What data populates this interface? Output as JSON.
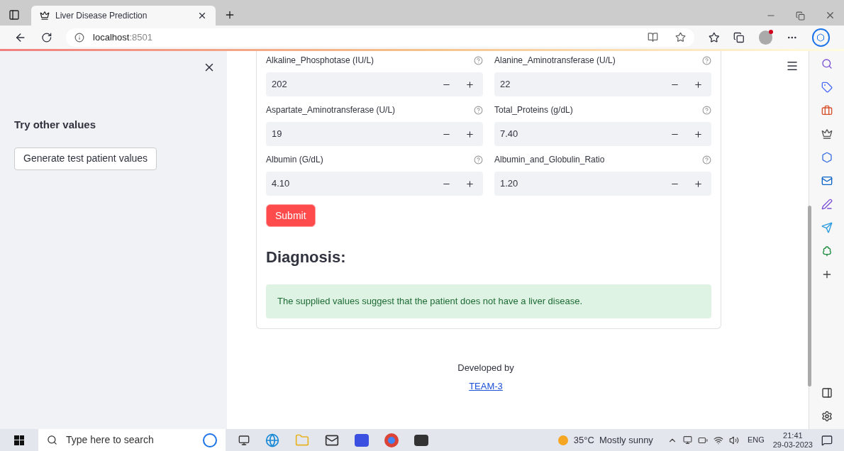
{
  "browser": {
    "tab_title": "Liver Disease Prediction",
    "url_host": "localhost",
    "url_port": ":8501"
  },
  "sidebar": {
    "heading": "Try other values",
    "button": "Generate test patient values"
  },
  "fields": [
    {
      "label": "Alkaline_Phosphotase (IU/L)",
      "value": "202"
    },
    {
      "label": "Alanine_Aminotransferase (U/L)",
      "value": "22"
    },
    {
      "label": "Aspartate_Aminotransferase (U/L)",
      "value": "19"
    },
    {
      "label": "Total_Proteins (g/dL)",
      "value": "7.40"
    },
    {
      "label": "Albumin (G/dL)",
      "value": "4.10"
    },
    {
      "label": "Albumin_and_Globulin_Ratio",
      "value": "1.20"
    }
  ],
  "submit": "Submit",
  "diagnosis": {
    "heading": "Diagnosis:",
    "message": "The supplied values suggest that the patient does not have a liver disease."
  },
  "footer": {
    "text": "Developed by",
    "link": "TEAM-3"
  },
  "taskbar": {
    "search_placeholder": "Type here to search",
    "weather": "35°C  Mostly sunny",
    "language": "ENG",
    "time": "21:41",
    "date": "29-03-2023"
  }
}
